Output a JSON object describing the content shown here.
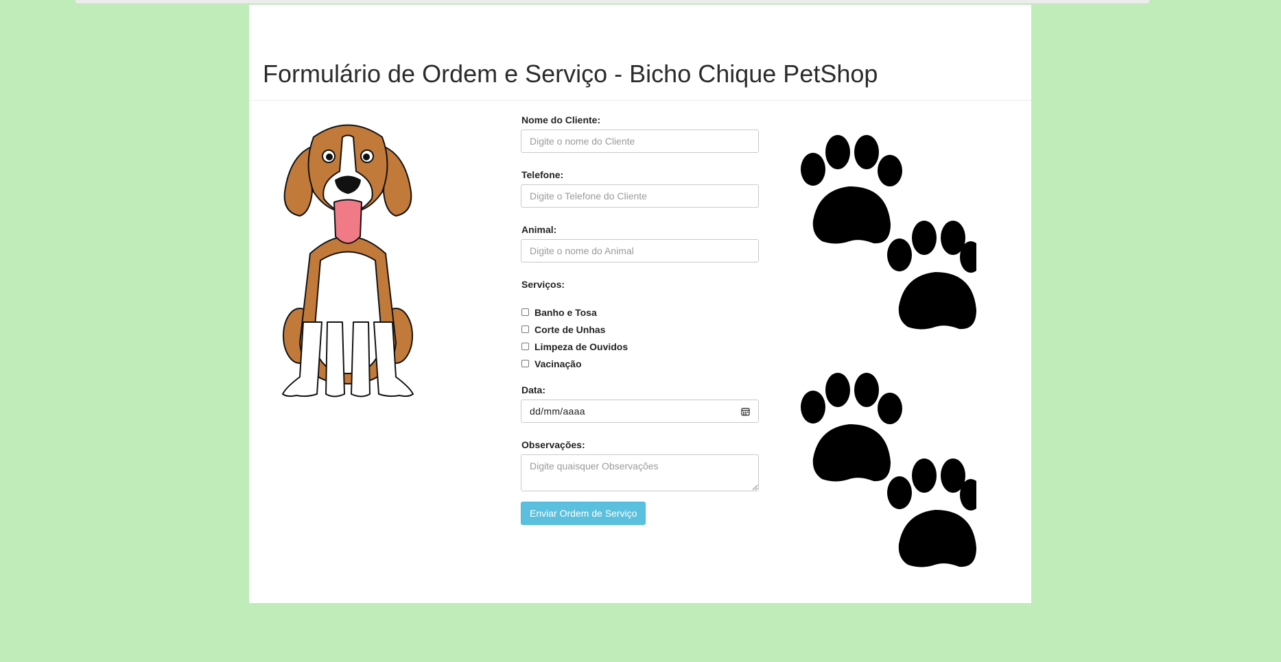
{
  "page": {
    "title": "Formulário de Ordem e Serviço - Bicho Chique PetShop"
  },
  "colors": {
    "background": "#bfecb9",
    "card": "#ffffff",
    "button": "#5bc0de",
    "paw": "#000000",
    "dog_brown": "#c27a3a",
    "tongue": "#f07a86"
  },
  "icons": {
    "dog": "beagle-dog-illustration",
    "paws": "paw-prints",
    "calendar": "calendar-icon"
  },
  "form": {
    "client": {
      "label": "Nome do Cliente:",
      "placeholder": "Digite o nome do Cliente",
      "value": ""
    },
    "phone": {
      "label": "Telefone:",
      "placeholder": "Digite o Telefone do Cliente",
      "value": ""
    },
    "animal": {
      "label": "Animal:",
      "placeholder": "Digite o nome do Animal",
      "value": ""
    },
    "services": {
      "label": "Serviços:",
      "options": [
        {
          "label": "Banho e Tosa",
          "checked": false
        },
        {
          "label": "Corte de Unhas",
          "checked": false
        },
        {
          "label": "Limpeza de Ouvidos",
          "checked": false
        },
        {
          "label": "Vacinação",
          "checked": false
        }
      ]
    },
    "date": {
      "label": "Data:",
      "placeholder": "dd/mm/aaaa"
    },
    "notes": {
      "label": "Observações:",
      "placeholder": "Digite quaisquer Observações",
      "value": ""
    },
    "submit_label": "Enviar Ordem de Serviço"
  }
}
